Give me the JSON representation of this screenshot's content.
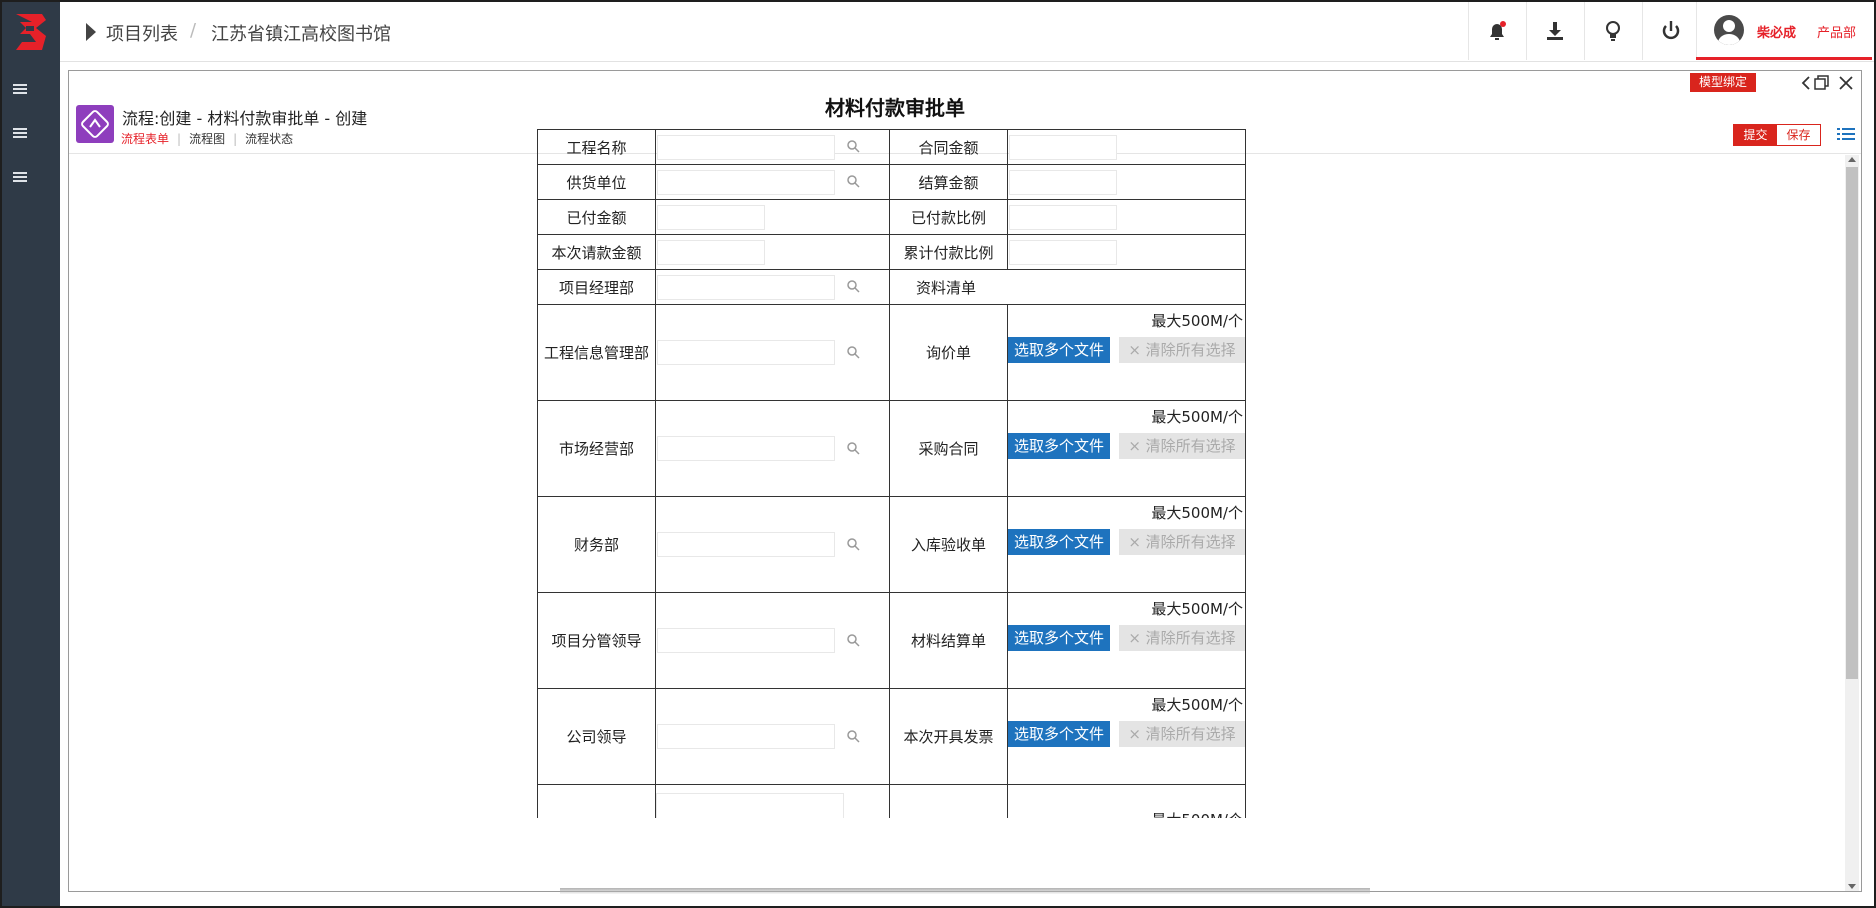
{
  "header": {
    "breadcrumb": [
      "项目列表",
      "江苏省镇江高校图书馆"
    ],
    "breadcrumb_sep": "/",
    "user": {
      "name": "柴必成",
      "dept": "产品部"
    }
  },
  "panel": {
    "model_bind_label": "模型绑定",
    "process_title": "流程:创建 - 材料付款审批单 - 创建",
    "subtabs": [
      "流程表单",
      "流程图",
      "流程状态"
    ],
    "actions": {
      "submit": "提交",
      "save": "保存"
    }
  },
  "form": {
    "title": "材料付款审批单",
    "rows": [
      {
        "left": "工程名称",
        "right": "合同金额"
      },
      {
        "left": "供货单位",
        "right": "结算金额"
      },
      {
        "left": "已付金额",
        "right": "已付款比例"
      },
      {
        "left": "本次请款金额",
        "right": "累计付款比例"
      },
      {
        "left": "项目经理部",
        "right": "资料清单"
      }
    ],
    "upload_rows": [
      {
        "left": "工程信息管理部",
        "right": "询价单"
      },
      {
        "left": "市场经营部",
        "right": "采购合同"
      },
      {
        "left": "财务部",
        "right": "入库验收单"
      },
      {
        "left": "项目分管领导",
        "right": "材料结算单"
      },
      {
        "left": "公司领导",
        "right": "本次开具发票"
      }
    ],
    "upload": {
      "max_size": "最大500M/个",
      "pick_label": "选取多个文件",
      "clear_label": "清除所有选择"
    }
  },
  "colors": {
    "accent": "#e62129",
    "sidebar": "#2f3a47",
    "upload_btn": "#1e73be",
    "process_icon": "#8e3ebd"
  }
}
